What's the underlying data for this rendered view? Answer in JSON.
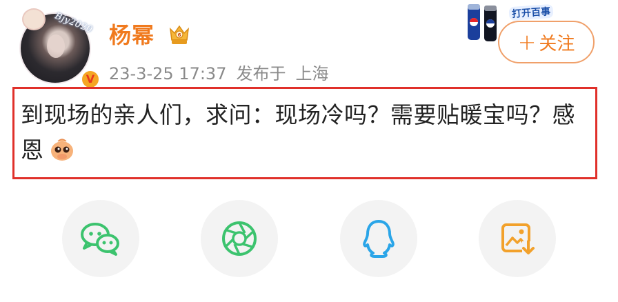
{
  "user": {
    "name": "杨幂",
    "avatar_text": "Bjy2020",
    "verified_glyph": "V"
  },
  "post": {
    "date": "23-3-25 17:37",
    "published_label": "发布于",
    "location": "上海",
    "text": "到现场的亲人们，求问：现场冷吗？需要贴暖宝吗？感恩"
  },
  "follow": {
    "plus": "+",
    "label": "关注"
  },
  "ad": {
    "text": "打开百事"
  },
  "share": {
    "items": [
      {
        "icon": "wechat-icon",
        "color": "#3cc36e"
      },
      {
        "icon": "moments-icon",
        "color": "#3cc36e"
      },
      {
        "icon": "qq-icon",
        "color": "#2aa5e8"
      },
      {
        "icon": "save-image-icon",
        "color": "#f2a12b"
      }
    ]
  },
  "colors": {
    "brand_orange": "#f07a1e",
    "highlight_red": "#e0302a",
    "meta_gray": "#8a8a8a"
  }
}
